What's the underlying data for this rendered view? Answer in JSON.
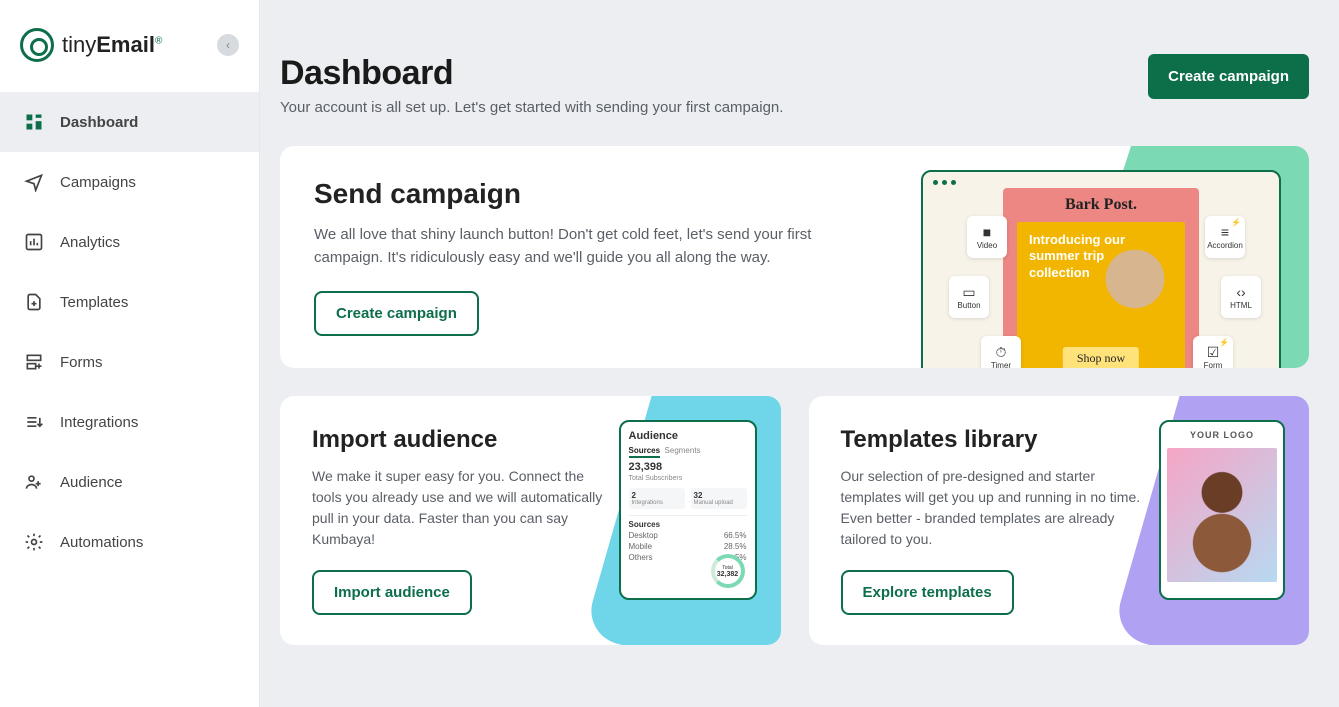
{
  "brand": {
    "name_light": "tiny",
    "name_bold": "Email"
  },
  "nav": {
    "dashboard": "Dashboard",
    "campaigns": "Campaigns",
    "analytics": "Analytics",
    "templates": "Templates",
    "forms": "Forms",
    "integrations": "Integrations",
    "audience": "Audience",
    "automations": "Automations"
  },
  "header": {
    "title": "Dashboard",
    "subtitle": "Your account is all set up. Let's get started with sending your first campaign.",
    "cta": "Create campaign"
  },
  "send": {
    "title": "Send campaign",
    "body": "We all love that shiny launch button! Don't get cold feet, let's send your first campaign. It's ridiculously easy and we'll guide you all along the way.",
    "cta": "Create campaign",
    "preview": {
      "brand": "Bark Post.",
      "headline": "Introducing our summer trip collection",
      "shop": "Shop now",
      "chips": {
        "video": "Video",
        "button": "Button",
        "timer": "Timer",
        "accordion": "Accordion",
        "html": "HTML",
        "form": "Form"
      }
    }
  },
  "import": {
    "title": "Import audience",
    "body": "We make it super easy for you. Connect the tools you already use and we will automatically pull in your data. Faster than you can say Kumbaya!",
    "cta": "Import audience",
    "mini": {
      "heading": "Audience",
      "tab_active": "Sources",
      "tab_other": "Segments",
      "total": "23,398",
      "total_label": "Total Subscribers",
      "s1": "2",
      "s1_label": "Integrations",
      "s2": "32",
      "s2_label": "Manual upload",
      "sources_label": "Sources",
      "r1a": "Desktop",
      "r1b": "66.5%",
      "r2a": "Mobile",
      "r2b": "28.5%",
      "r3a": "Others",
      "r3b": "5%",
      "donut_total_label": "Total",
      "donut_total": "32,382"
    }
  },
  "templates": {
    "title": "Templates library",
    "body": "Our selection of pre-designed and starter templates will get you up and running in no time. Even better - branded templates are already tailored to you.",
    "cta": "Explore templates",
    "logo_text": "YOUR LOGO"
  }
}
